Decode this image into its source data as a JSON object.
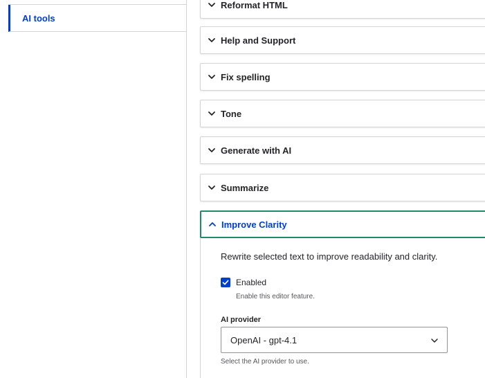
{
  "sidebar": {
    "tab_label": "AI tools"
  },
  "accordion": {
    "items": [
      {
        "label": "Reformat HTML",
        "expanded": false
      },
      {
        "label": "Help and Support",
        "expanded": false
      },
      {
        "label": "Fix spelling",
        "expanded": false
      },
      {
        "label": "Tone",
        "expanded": false
      },
      {
        "label": "Generate with AI",
        "expanded": false
      },
      {
        "label": "Summarize",
        "expanded": false
      },
      {
        "label": "Improve Clarity",
        "expanded": true
      }
    ]
  },
  "improve_clarity": {
    "description": "Rewrite selected text to improve readability and clarity.",
    "enabled_label": "Enabled",
    "enabled_checked": true,
    "enabled_help": "Enable this editor feature.",
    "provider_label": "AI provider",
    "provider_value": "OpenAI - gpt-4.1",
    "provider_help": "Select the AI provider to use."
  },
  "colors": {
    "accent": "#003ecc",
    "focus_border": "#1f8a6a",
    "border": "#d3d4d9",
    "text": "#232429"
  },
  "icons": {
    "collapsed": "chevron-down-icon",
    "expanded": "chevron-up-icon",
    "select": "chevron-down-icon",
    "checkbox": "checkmark-icon"
  }
}
